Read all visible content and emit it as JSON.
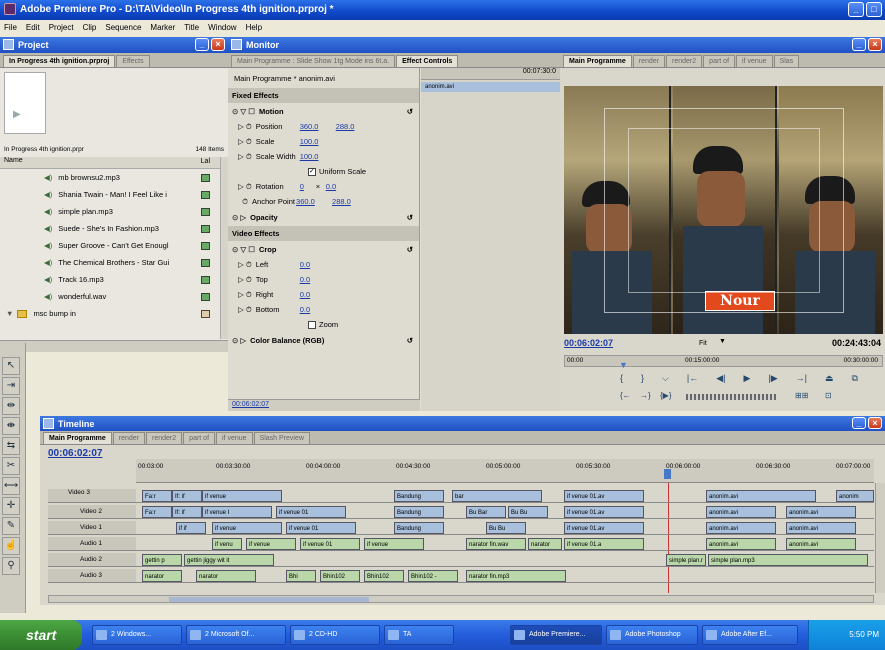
{
  "window": {
    "title": "Adobe Premiere Pro - D:\\TA\\Video\\In Progress 4th ignition.prproj *"
  },
  "menu": [
    "File",
    "Edit",
    "Project",
    "Clip",
    "Sequence",
    "Marker",
    "Title",
    "Window",
    "Help"
  ],
  "project": {
    "panel_title": "Project",
    "tabs": [
      "In Progress 4th ignition.prproj",
      "Effects"
    ],
    "file_name": "In Progress 4th ignition.prpr",
    "item_count": "148 Items",
    "col_name": "Name",
    "col_label": "Lal",
    "items": [
      "mb brownsu2.mp3",
      "Shania Twain - Man! I Feel Like i",
      "simple plan.mp3",
      "Suede - She's In Fashion.mp3",
      "Super Groove - Can't Get Enougl",
      "The Chemical Brothers - Star Gui",
      "Track 16.mp3",
      "wonderful.wav"
    ],
    "bin": "msc bump in"
  },
  "monitor": {
    "panel_title": "Monitor",
    "tabs": [
      "Main Programme : Slide Show 1tg Mode ins 6t.a.",
      "Effect Controls"
    ],
    "program_tabs": [
      "Main Programme",
      "render",
      "render2",
      "part of",
      "if venue",
      "Slas"
    ],
    "sequence_label": "Main Programme * anonim.avi",
    "ruler_time": "00:07:30:0",
    "clip_name": "anonim.avi",
    "fixed_effects": "Fixed Effects",
    "motion": "Motion",
    "position": {
      "label": "Position",
      "x": "360.0",
      "y": "288.0"
    },
    "scale": {
      "label": "Scale",
      "value": "100.0"
    },
    "scale_width": {
      "label": "Scale Width",
      "value": "100.0"
    },
    "uniform_scale": "Uniform Scale",
    "rotation": {
      "label": "Rotation",
      "a": "0",
      "b": "0.0"
    },
    "anchor": {
      "label": "Anchor Point",
      "x": "360.0",
      "y": "288.0"
    },
    "opacity": "Opacity",
    "video_effects": "Video Effects",
    "crop": "Crop",
    "crop_rows": [
      {
        "label": "Left",
        "value": "0.0"
      },
      {
        "label": "Top",
        "value": "0.0"
      },
      {
        "label": "Right",
        "value": "0.0"
      },
      {
        "label": "Bottom",
        "value": "0.0"
      }
    ],
    "zoom": "Zoom",
    "color_balance": "Color Balance (RGB)",
    "ec_timecode": "00:06:02:07",
    "overlay_title": "Nour",
    "current_time": "00:06:02:07",
    "fit": "Fit",
    "duration": "00:24:43:04",
    "ruler": [
      "00:00",
      "00:15:00:00",
      "00:30:00:00"
    ]
  },
  "timeline": {
    "panel_title": "Timeline",
    "tabs": [
      "Main Programme",
      "render",
      "render2",
      "part of",
      "if venue",
      "Slash Preview"
    ],
    "timecode": "00:06:02:07",
    "ruler": [
      "00:03:00",
      "00:03:30:00",
      "00:04:00:00",
      "00:04:30:00",
      "00:05:00:00",
      "00:05:30:00",
      "00:06:00:00",
      "00:06:30:00",
      "00:07:00:00"
    ],
    "tracks": [
      "Video 3",
      "Video 2",
      "Video 1",
      "Audio 1",
      "Audio 2",
      "Audio 3"
    ],
    "clips": {
      "v3": [
        "Fa:r",
        "If: if",
        "if venue",
        "Bandung",
        "bar",
        "if venue 01.av",
        "anonim.avi",
        "anonim"
      ],
      "v2": [
        "Fa:r",
        "If: if",
        "if venue I",
        "if venue 01",
        "Bandung",
        "Bu Bar",
        "Bu Bu",
        "if venue 01.av",
        "anonim.avi",
        "anonim.avi"
      ],
      "v1": [
        "if if",
        "if venue",
        "if venue 01",
        "Bandung",
        "Bu Bu",
        "if venue 01.av",
        "anonim.avi",
        "anonim.avi"
      ],
      "a1": [
        "if venu",
        "if venue",
        "if venue 01",
        "if venue",
        "narator fin.wav",
        "narator",
        "if venue 01.a",
        "anonim.avi",
        "anonim.avi"
      ],
      "a2": [
        "gettin p",
        "gettin jiggy wit it",
        "simple plan.r",
        "simple plan.mp3"
      ],
      "a3": [
        "narator",
        "narator",
        "Bhi",
        "Bhin102",
        "Bhin102",
        "Bhin102 -",
        "narator fin.mp3"
      ]
    }
  },
  "taskbar": {
    "start": "start",
    "buttons": [
      "2 Windows...",
      "2 Microsoft Of...",
      "2 CD-HD",
      "TA",
      "Adobe Premiere...",
      "Adobe Photoshop",
      "Adobe After Ef..."
    ],
    "clock": "5:50 PM"
  }
}
